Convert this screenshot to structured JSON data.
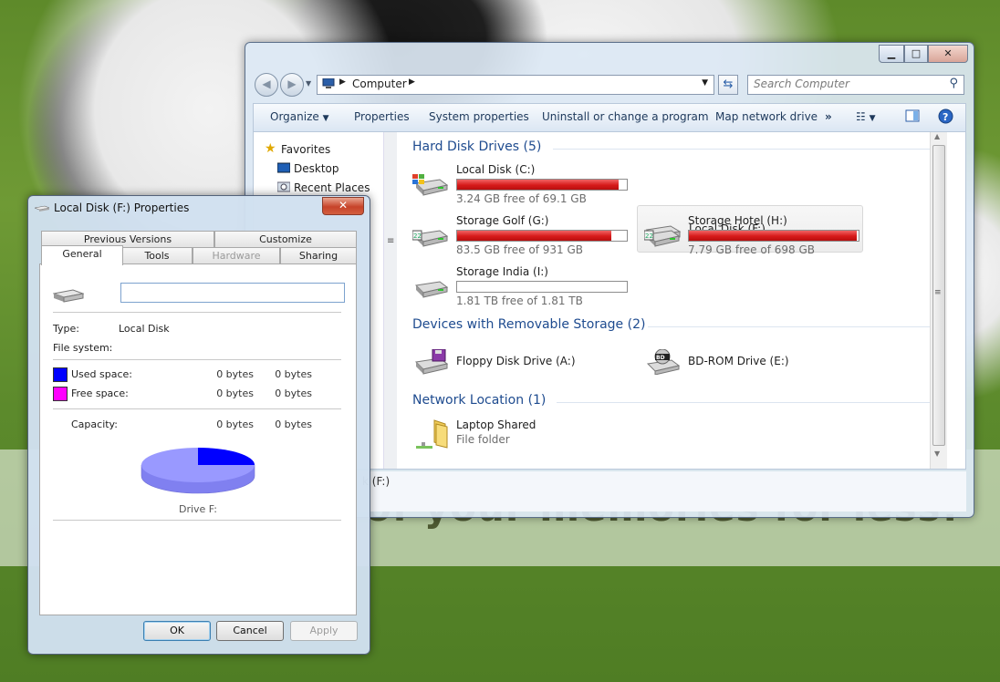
{
  "watermark": "of your memories for less!",
  "explorer": {
    "address": {
      "segment": "Computer"
    },
    "search_placeholder": "Search Computer",
    "toolbar": {
      "organize": "Organize",
      "properties": "Properties",
      "system_properties": "System properties",
      "uninstall": "Uninstall or change a program",
      "map_drive": "Map network drive",
      "more": "»"
    },
    "nav": [
      {
        "label": "Favorites"
      },
      {
        "label": "Desktop"
      },
      {
        "label": "Recent Places"
      }
    ],
    "groups": {
      "hdd": "Hard Disk Drives (5)",
      "removable": "Devices with Removable Storage (2)",
      "network": "Network Location (1)"
    },
    "drives": [
      {
        "name": "Local Disk (C:)",
        "free": "3.24 GB free of 69.1 GB",
        "used_fraction": 0.953
      },
      {
        "name": "Local Disk (F:)"
      },
      {
        "name": "Storage Golf (G:)",
        "free": "83.5 GB free of 931 GB",
        "used_fraction": 0.91
      },
      {
        "name": "Storage Hotel (H:)",
        "free": "7.79 GB free of 698 GB",
        "used_fraction": 0.989
      },
      {
        "name": "Storage India (I:)",
        "free": "1.81 TB free of 1.81 TB",
        "used_fraction": 0.0
      }
    ],
    "removable": [
      {
        "name": "Floppy Disk Drive (A:)"
      },
      {
        "name": "BD-ROM Drive (E:)"
      }
    ],
    "network": [
      {
        "name": "Laptop Shared",
        "type": "File folder"
      }
    ],
    "details_text": "k (F:)"
  },
  "props": {
    "title": "Local Disk (F:) Properties",
    "close": "✕",
    "tabs_top": [
      "Previous Versions",
      "Customize"
    ],
    "tabs_bottom": [
      "General",
      "Tools",
      "Hardware",
      "Sharing"
    ],
    "type_label": "Type:",
    "type_value": "Local Disk",
    "fs_label": "File system:",
    "used_label": "Used space:",
    "used_bytes": "0 bytes",
    "used_bytes2": "0 bytes",
    "free_label": "Free space:",
    "free_bytes": "0 bytes",
    "free_bytes2": "0 bytes",
    "capacity_label": "Capacity:",
    "cap_bytes": "0 bytes",
    "cap_bytes2": "0 bytes",
    "drive_label": "Drive F:",
    "used_color": "#0000ff",
    "free_color": "#ff00ff",
    "buttons": {
      "ok": "OK",
      "cancel": "Cancel",
      "apply": "Apply"
    }
  }
}
